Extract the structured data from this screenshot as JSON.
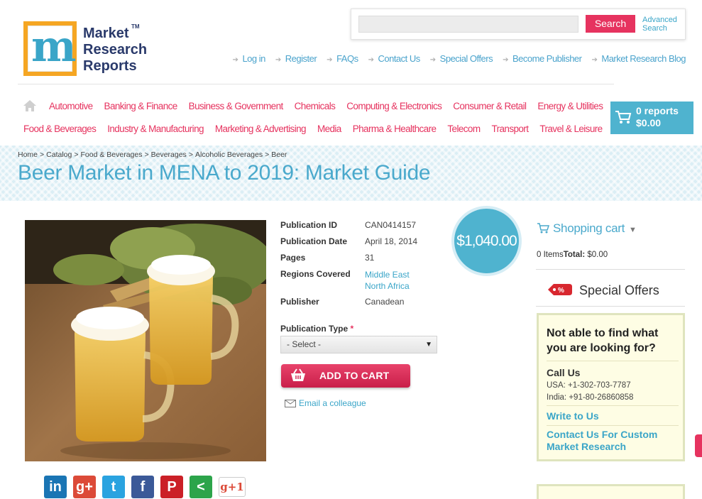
{
  "logo": {
    "line1": "Market",
    "line2": "Research",
    "line3": "Reports",
    "tm": "TM"
  },
  "search": {
    "value": "",
    "button": "Search",
    "advanced_line1": "Advanced",
    "advanced_line2": "Search"
  },
  "top_links": [
    "Log in",
    "Register",
    "FAQs",
    "Contact Us",
    "Special Offers",
    "Become Publisher",
    "Market Research Blog"
  ],
  "categories_row1": [
    "Automotive",
    "Banking & Finance",
    "Business & Government",
    "Chemicals",
    "Computing & Electronics",
    "Consumer & Retail",
    "Energy & Utilities"
  ],
  "categories_row2": [
    "Food & Beverages",
    "Industry & Manufacturing",
    "Marketing & Advertising",
    "Media",
    "Pharma & Healthcare",
    "Telecom",
    "Transport",
    "Travel & Leisure"
  ],
  "cart": {
    "reports": "0 reports",
    "total": "$0.00"
  },
  "breadcrumb": [
    "Home",
    "Catalog",
    "Food & Beverages",
    "Beverages",
    "Alcoholic Beverages",
    "Beer"
  ],
  "page_title": "Beer Market in MENA to 2019: Market Guide",
  "details": {
    "publication_id_label": "Publication ID",
    "publication_id": "CAN0414157",
    "publication_date_label": "Publication Date",
    "publication_date": "April 18, 2014",
    "pages_label": "Pages",
    "pages": "31",
    "regions_label": "Regions Covered",
    "region1": "Middle East",
    "region2": "North Africa",
    "publisher_label": "Publisher",
    "publisher": "Canadean"
  },
  "price": "$1,040.00",
  "publication_type": {
    "label": "Publication Type",
    "required_mark": "*",
    "selected": "- Select -"
  },
  "add_to_cart": "ADD TO CART",
  "email_colleague": "Email a colleague",
  "social": {
    "linkedin": "in",
    "googleplus": "g+",
    "twitter": "t",
    "facebook": "f",
    "pinterest": "P",
    "share": "<",
    "gplusone": "g+1"
  },
  "sidebar": {
    "cart_title": "Shopping cart",
    "items": "0 Items",
    "total_label": "Total:",
    "total_value": "$0.00",
    "special_offers": "Special Offers",
    "help_title_line1": "Not able to find what",
    "help_title_line2": "you are looking for?",
    "call_us": "Call Us",
    "phone_usa": "USA: +1-302-703-7787",
    "phone_india": "India: +91-80-26860858",
    "write_to_us": "Write to Us",
    "custom_line1": "Contact Us For Custom",
    "custom_line2": "Market Research"
  },
  "colors": {
    "brand_blue": "#4aa9cc",
    "accent_pink": "#e6335f",
    "logo_orange": "#f5a623",
    "logo_green": "#8cc63f"
  }
}
